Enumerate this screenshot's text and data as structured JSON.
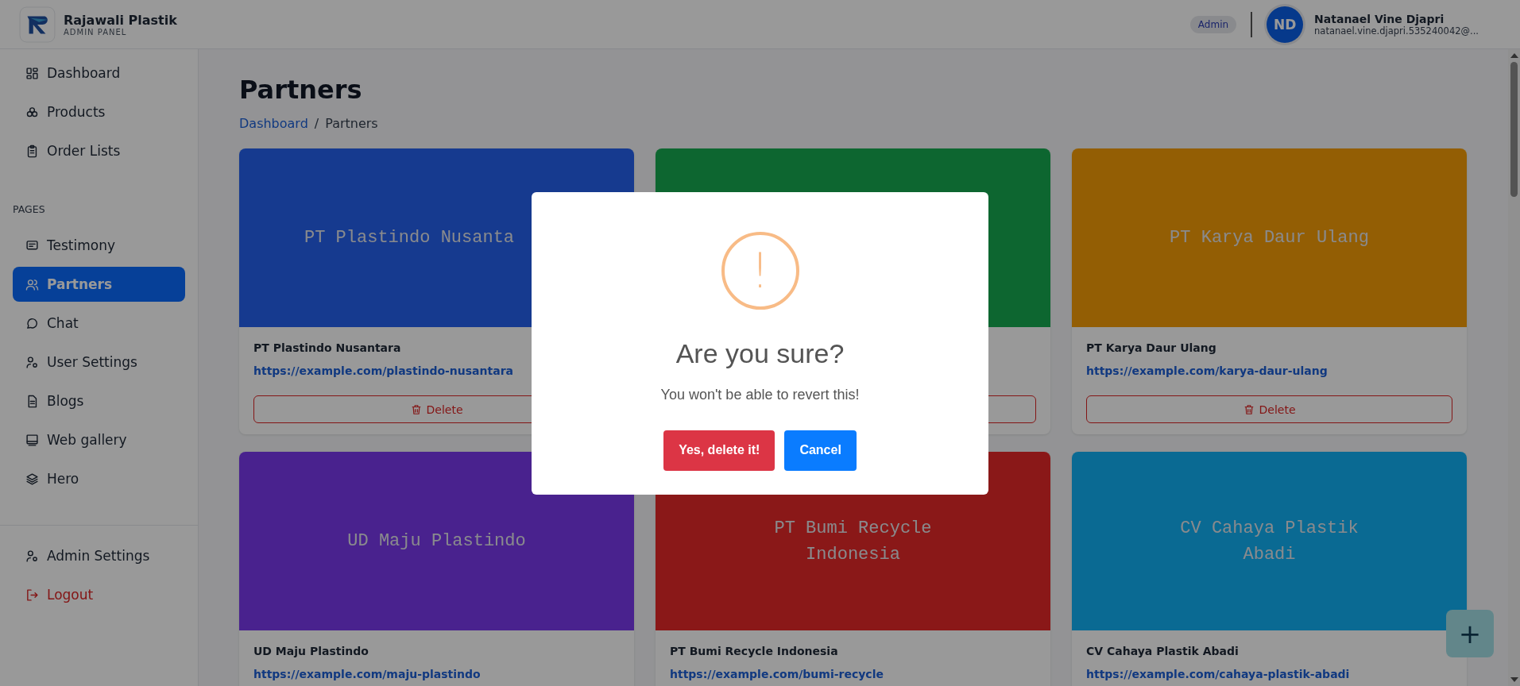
{
  "brand": {
    "name": "Rajawali Plastik",
    "subtitle": "ADMIN PANEL"
  },
  "header": {
    "role_badge": "Admin",
    "user": {
      "initials": "ND",
      "name": "Natanael Vine Djapri",
      "email": "natanael.vine.djapri.535240042@..."
    }
  },
  "sidebar": {
    "items": [
      {
        "label": "Dashboard",
        "selected": false
      },
      {
        "label": "Products",
        "selected": false
      },
      {
        "label": "Order Lists",
        "selected": false
      }
    ],
    "section_title": "PAGES",
    "pages": [
      {
        "label": "Testimony",
        "selected": false
      },
      {
        "label": "Partners",
        "selected": true
      },
      {
        "label": "Chat",
        "selected": false
      },
      {
        "label": "User Settings",
        "selected": false
      },
      {
        "label": "Blogs",
        "selected": false
      },
      {
        "label": "Web gallery",
        "selected": false
      },
      {
        "label": "Hero",
        "selected": false
      }
    ],
    "footer": [
      {
        "label": "Admin Settings",
        "kind": "normal"
      },
      {
        "label": "Logout",
        "kind": "danger"
      }
    ]
  },
  "page": {
    "title": "Partners",
    "breadcrumb": [
      {
        "label": "Dashboard",
        "kind": "link"
      },
      {
        "label": "/",
        "kind": "separator"
      },
      {
        "label": "Partners",
        "kind": "current"
      }
    ]
  },
  "cards": [
    {
      "color": "#163a8f",
      "banner": "PT Plastindo Nusanta",
      "banner_cut": true,
      "name": "PT Plastindo Nusantara",
      "url": "https://example.com/plastindo-nusantara",
      "actions_visible": true,
      "delete": "Delete"
    },
    {
      "color": "#0d6630",
      "actions_visible": true
    },
    {
      "color": "#935e05",
      "banner": "PT Karya Daur Ulang",
      "name": "PT Karya Daur Ulang",
      "url": "https://example.com/karya-daur-ulang",
      "actions_visible": true,
      "delete": "Delete"
    },
    {
      "color": "#4a238e",
      "banner": "UD Maju Plastindo",
      "name": "UD Maju Plastindo",
      "url": "https://example.com/maju-plastindo",
      "actions_visible": false
    },
    {
      "color": "#8a1818",
      "banner": "PT Bumi Recycle Indonesia",
      "name": "PT Bumi Recycle Indonesia",
      "url": "https://example.com/bumi-recycle",
      "actions_visible": false
    },
    {
      "color": "#0a6a93",
      "banner": "CV Cahaya Plastik Abadi",
      "name": "CV Cahaya Plastik Abadi",
      "url": "https://example.com/cahaya-plastik-abadi",
      "actions_visible": false
    }
  ],
  "fab": {
    "label": "+"
  },
  "dialog": {
    "icon": "!",
    "title": "Are you sure?",
    "text": "You won't be able to revert this!",
    "confirm": "Yes, delete it!",
    "cancel": "Cancel"
  }
}
